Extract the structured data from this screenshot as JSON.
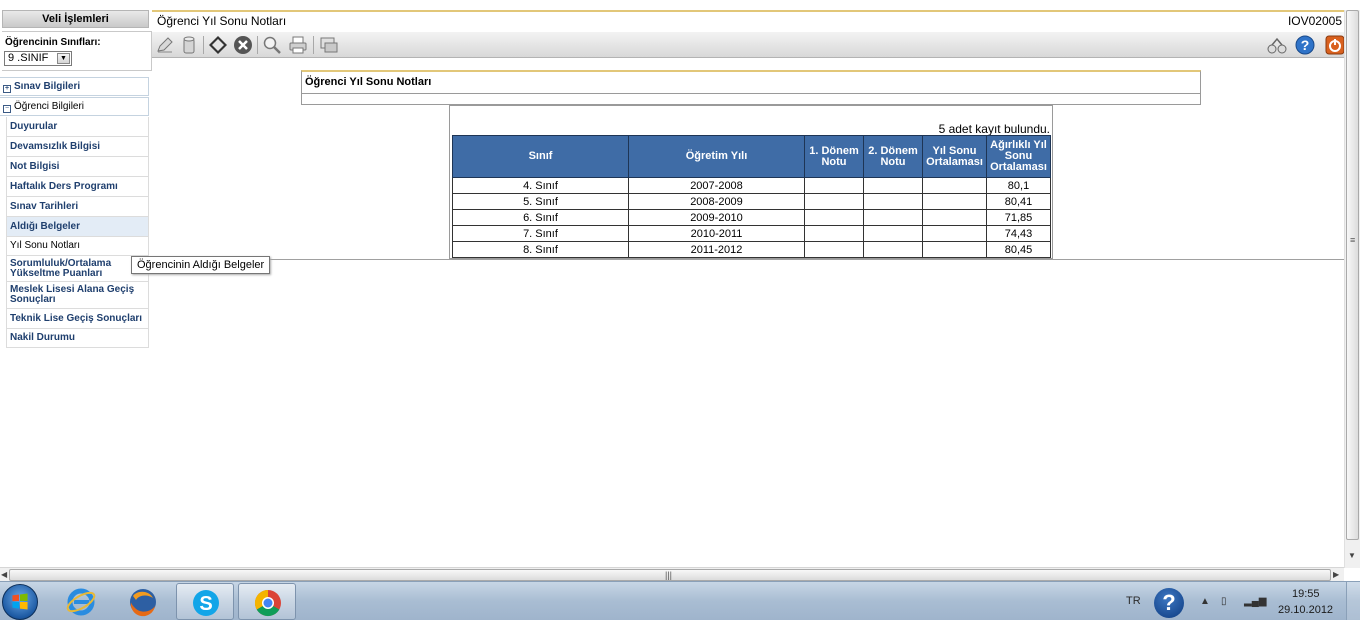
{
  "sidebar": {
    "title": "Veli İşlemleri",
    "class_label": "Öğrencinin Sınıfları:",
    "class_value": "9 .SINIF",
    "sections": [
      {
        "label": "Sınav Bilgileri",
        "toggle": "⊞"
      },
      {
        "label": "Öğrenci Bilgileri",
        "toggle": "⊟"
      }
    ],
    "items": [
      {
        "label": "Duyurular"
      },
      {
        "label": "Devamsızlık Bilgisi"
      },
      {
        "label": "Not Bilgisi"
      },
      {
        "label": "Haftalık Ders Programı"
      },
      {
        "label": "Sınav Tarihleri"
      },
      {
        "label": "Aldığı Belgeler"
      },
      {
        "label": "Yıl Sonu Notları"
      },
      {
        "label": "Sorumluluk/Ortalama Yükseltme Puanları"
      },
      {
        "label": "Meslek Lisesi Alana Geçiş Sonuçları"
      },
      {
        "label": "Teknik Lise Geçiş Sonuçları"
      },
      {
        "label": "Nakil Durumu"
      }
    ],
    "tooltip": "Öğrencinin Aldığı Belgeler"
  },
  "header": {
    "title": "Öğrenci Yıl Sonu Notları",
    "code": "IOV02005"
  },
  "toolbar": {
    "left_icons": [
      "edit-icon",
      "delete-icon",
      "save-icon",
      "cancel-icon",
      "search-icon",
      "print-icon",
      "report-icon"
    ],
    "right_icons": [
      "network-icon",
      "help-icon",
      "power-icon"
    ]
  },
  "panel": {
    "title": "Öğrenci Yıl Sonu Notları"
  },
  "grid": {
    "record_count": "5 adet kayıt bulundu.",
    "columns": [
      "Sınıf",
      "Öğretim Yılı",
      "1. Dönem Notu",
      "2. Dönem Notu",
      "Yıl Sonu Ortalaması",
      "Ağırlıklı Yıl Sonu Ortalaması"
    ],
    "rows": [
      [
        "4. Sınıf",
        "2007-2008",
        "",
        "",
        "",
        "80,1"
      ],
      [
        "5. Sınıf",
        "2008-2009",
        "",
        "",
        "",
        "80,41"
      ],
      [
        "6. Sınıf",
        "2009-2010",
        "",
        "",
        "",
        "71,85"
      ],
      [
        "7. Sınıf",
        "2010-2011",
        "",
        "",
        "",
        "74,43"
      ],
      [
        "8. Sınıf",
        "2011-2012",
        "",
        "",
        "",
        "80,45"
      ]
    ]
  },
  "taskbar": {
    "apps": [
      "internet-explorer-icon",
      "firefox-icon",
      "skype-icon",
      "chrome-icon"
    ],
    "language": "TR",
    "time": "19:55",
    "date": "29.10.2012"
  },
  "colors": {
    "grid_header": "#3f6ca6",
    "accent_border": "#e2c779",
    "link": "#1f3f6e"
  }
}
